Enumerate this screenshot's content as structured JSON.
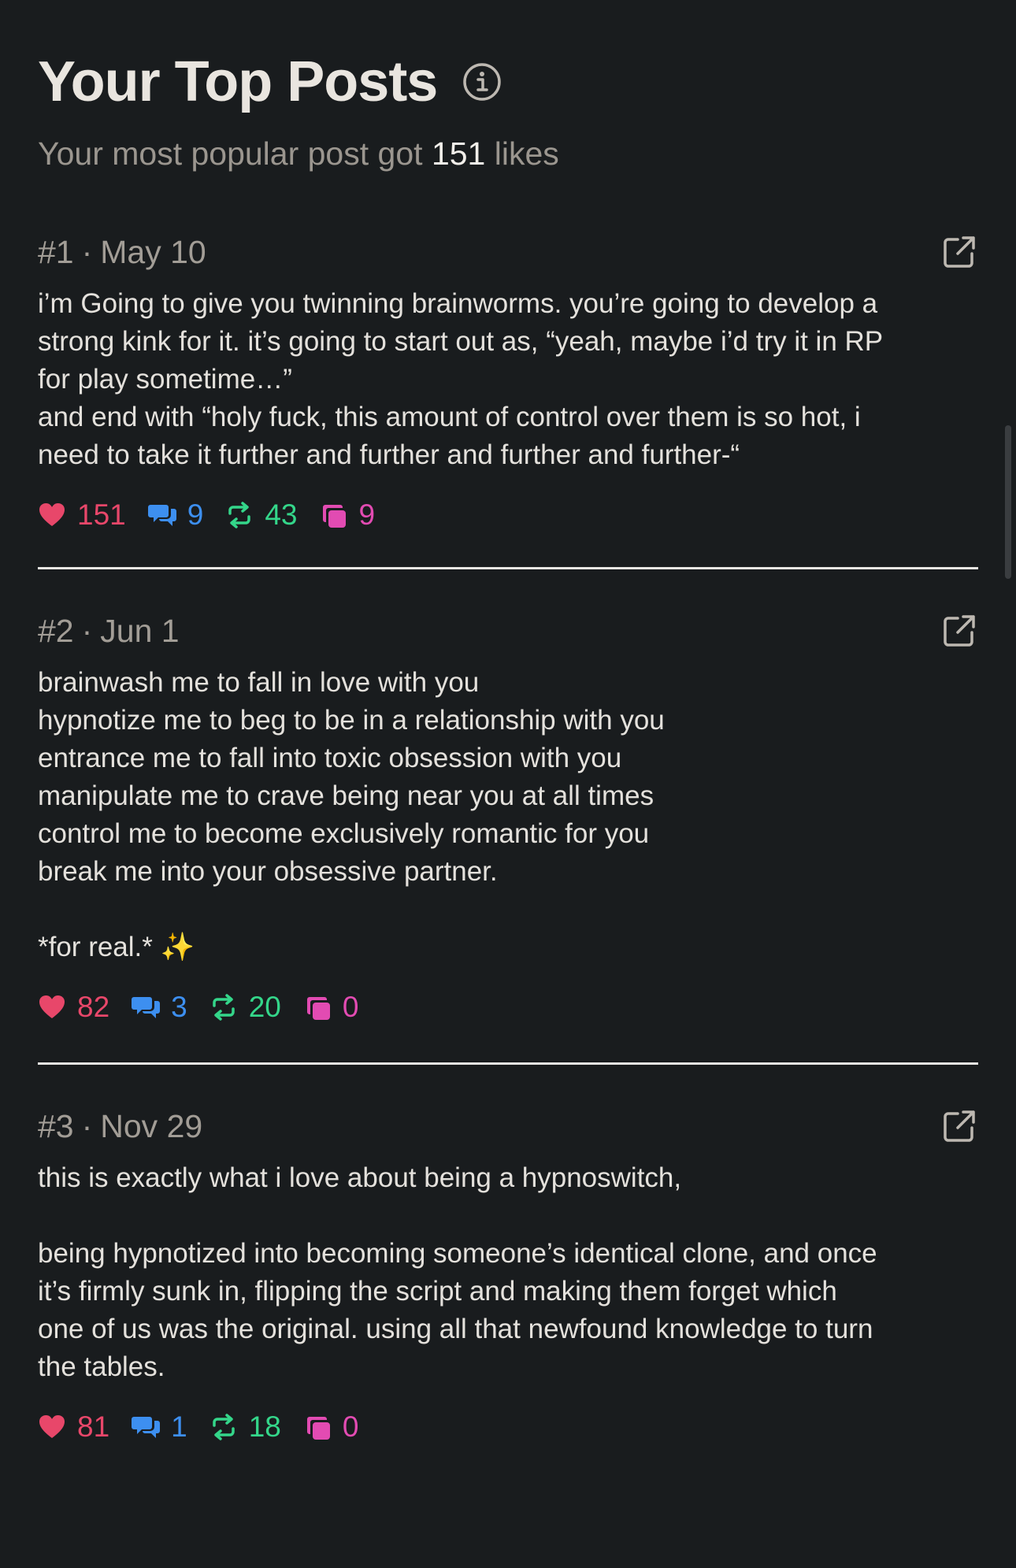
{
  "header": {
    "title": "Your Top Posts",
    "subtitle_prefix": "Your most popular post got",
    "subtitle_count": "151",
    "subtitle_suffix": "likes"
  },
  "colors": {
    "background": "#191c1e",
    "likes": "#e8476a",
    "replies": "#3d8ff0",
    "reblogs": "#34d68a",
    "quotes": "#e24bb2"
  },
  "posts": [
    {
      "rank": "#1",
      "date": "May 10",
      "body": "i’m Going to give you twinning brainworms. you’re going to develop a\nstrong kink for it. it’s going to start out as, “yeah, maybe i’d try it in RP\nfor play sometime…”\nand end with “holy fuck, this amount of control over them is so hot, i\nneed to take it further and further and further and further-“",
      "likes": "151",
      "replies": "9",
      "reblogs": "43",
      "quotes": "9"
    },
    {
      "rank": "#2",
      "date": "Jun 1",
      "body": "brainwash me to fall in love with you\nhypnotize me to beg to be in a relationship with you\nentrance me to fall into toxic obsession with you\nmanipulate me to crave being near you at all times\ncontrol me to become exclusively romantic for you\nbreak me into your obsessive partner.\n\n*for real.* ✨",
      "likes": "82",
      "replies": "3",
      "reblogs": "20",
      "quotes": "0"
    },
    {
      "rank": "#3",
      "date": "Nov 29",
      "body": "this is exactly what i love about being a hypnoswitch,\n\nbeing hypnotized into becoming someone’s identical clone, and once\nit’s firmly sunk in, flipping the script and making them forget which\none of us was the original. using all that newfound knowledge to turn\nthe tables.",
      "likes": "81",
      "replies": "1",
      "reblogs": "18",
      "quotes": "0"
    }
  ]
}
